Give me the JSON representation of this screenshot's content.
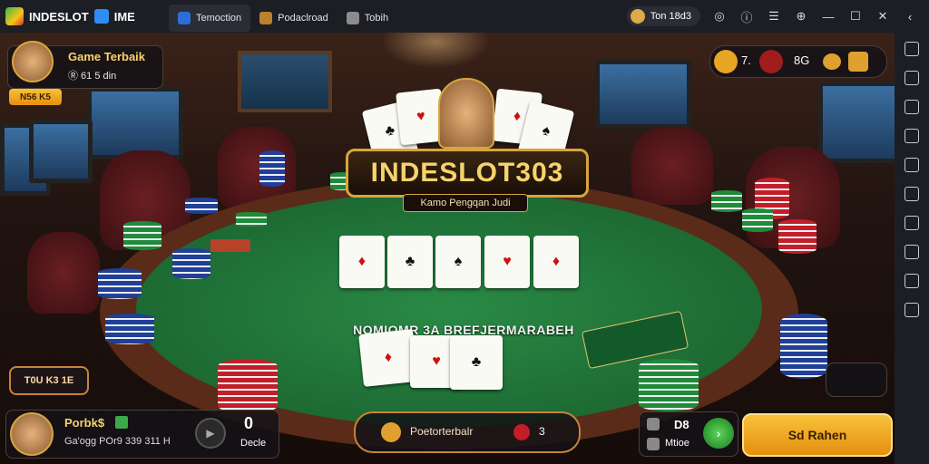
{
  "app": {
    "title": "INDESLOT",
    "badge": "IME"
  },
  "tabs": [
    {
      "label": "Temoction"
    },
    {
      "label": "Podaclroad"
    },
    {
      "label": "Tobih"
    }
  ],
  "account": {
    "label": "Ton 18d3"
  },
  "game": {
    "logo": "INDESLOT303",
    "subtitle": "Kamo Pengqan Judi",
    "table_text": "NOMIOMR 3A BREFJERMARABEH",
    "player_panel": {
      "title": "Game Terbaik",
      "line": "Ⓡ 61 5 din",
      "button": "N56 K5"
    },
    "left_button": "T0U K3 1E",
    "bottom_player": {
      "name": "Porbk$",
      "line": "Ga'ogg POr9 339 311 H",
      "value": "0",
      "value_label": "Decle"
    },
    "center_pill": {
      "label": "Poetorterbalr",
      "value": "3"
    },
    "right_panel": {
      "value": "D8",
      "label": "Mtioe"
    },
    "cta": "Sd Rahen",
    "top_icons": {
      "a": "7.",
      "b": "8G"
    }
  },
  "colors": {
    "accent": "#f5b329",
    "felt": "#1d6a33"
  }
}
